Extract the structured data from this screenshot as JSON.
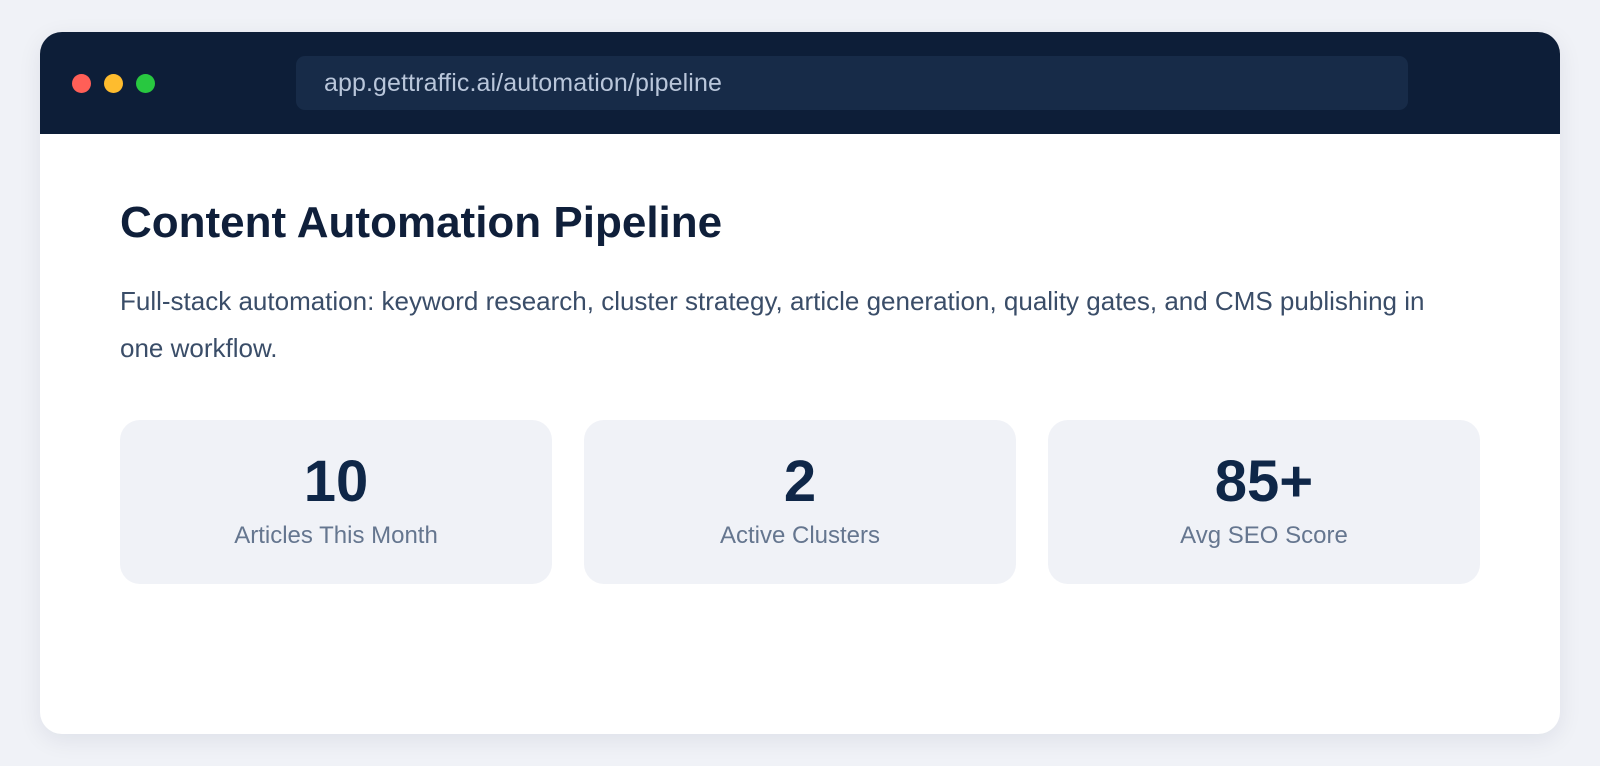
{
  "browser": {
    "url": "app.gettraffic.ai/automation/pipeline"
  },
  "page": {
    "title": "Content Automation Pipeline",
    "description": "Full-stack automation: keyword research, cluster strategy, article generation, quality gates, and CMS publishing in one workflow."
  },
  "stats": [
    {
      "value": "10",
      "label": "Articles This Month"
    },
    {
      "value": "2",
      "label": "Active Clusters"
    },
    {
      "value": "85+",
      "label": "Avg SEO Score"
    }
  ],
  "colors": {
    "titlebar": "#0d1e38",
    "addressbar": "#172b48",
    "close_dot": "#ff5f57",
    "minimize_dot": "#febc2e",
    "maximize_dot": "#28c840",
    "heading": "#0f1f3a",
    "stat_value": "#0f2748",
    "card_background": "#f0f2f7"
  }
}
